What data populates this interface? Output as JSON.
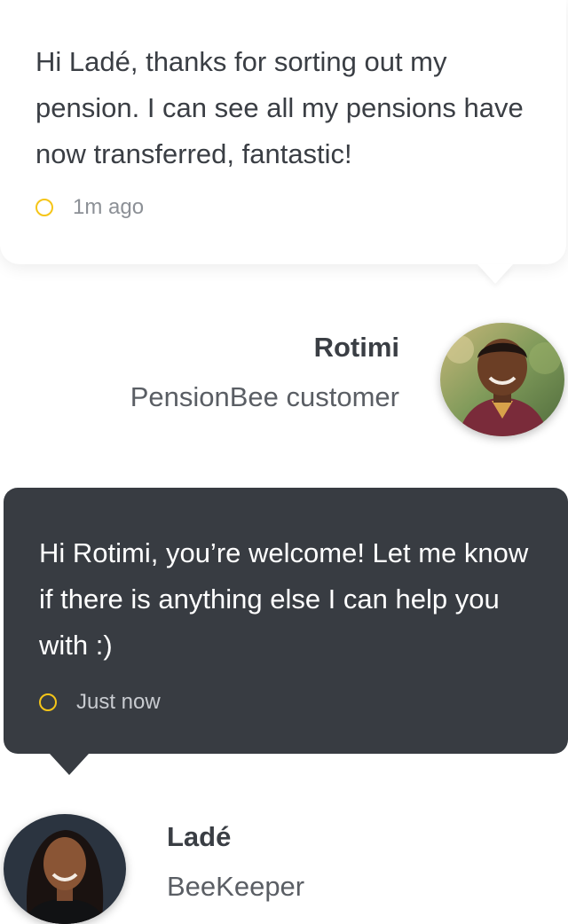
{
  "customer_message": {
    "text": "Hi Ladé, thanks for sorting out my pension. I can see all my pensions have now transferred, fantastic!",
    "time": "1m ago"
  },
  "customer": {
    "name": "Rotimi",
    "role": "PensionBee customer"
  },
  "keeper_message": {
    "text": "Hi Rotimi, you’re welcome! Let me know if there is anything else I can help you with :)",
    "time": "Just now"
  },
  "keeper": {
    "name": "Ladé",
    "role": "BeeKeeper"
  },
  "colors": {
    "accent": "#f5c518",
    "dark_bubble": "#383c42",
    "text": "#3a3e44"
  },
  "icons": {
    "time": "clock-icon",
    "avatar": "profile-photo"
  }
}
